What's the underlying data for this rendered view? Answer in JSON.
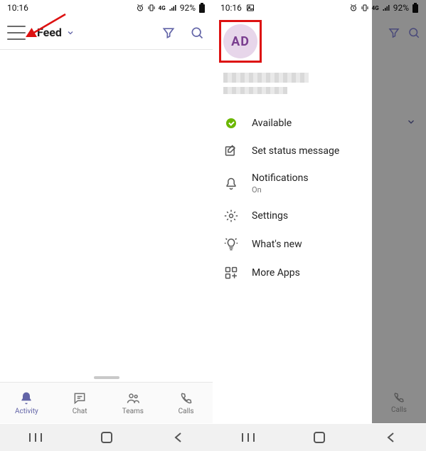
{
  "status": {
    "time": "10:16",
    "battery_pct": "92%"
  },
  "left": {
    "header_title": "Feed",
    "tabs": {
      "activity": "Activity",
      "chat": "Chat",
      "teams": "Teams",
      "calls": "Calls"
    }
  },
  "right": {
    "avatar_initials": "AD",
    "presence_label": "Available",
    "menu": {
      "status_msg": "Set status message",
      "notifications": "Notifications",
      "notifications_sub": "On",
      "settings": "Settings",
      "whatsnew": "What's new",
      "moreapps": "More Apps"
    },
    "calls_label": "Calls"
  },
  "colors": {
    "accent": "#6264A7",
    "presence_green": "#6bb700",
    "annotation_red": "#d11"
  }
}
